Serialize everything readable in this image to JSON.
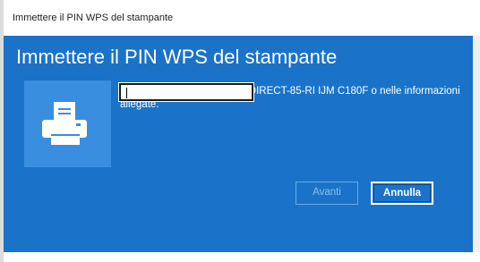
{
  "window": {
    "title": "Immettere il PIN WPS del stampante"
  },
  "dialog": {
    "heading": "Immettere il PIN WPS del stampante",
    "description": "Puoi trovare il PIN WPS nel DIRECT-85-RI IJM C180F o nelle informazioni allegate.",
    "pin_input": {
      "value": "",
      "placeholder": ""
    },
    "buttons": {
      "next_label": "Avanti",
      "cancel_label": "Annulla"
    }
  },
  "colors": {
    "dialog_background": "#1a73c8",
    "printer_tile": "#3a8ee0",
    "text": "#ffffff"
  },
  "icons": {
    "device": "printer-icon"
  }
}
